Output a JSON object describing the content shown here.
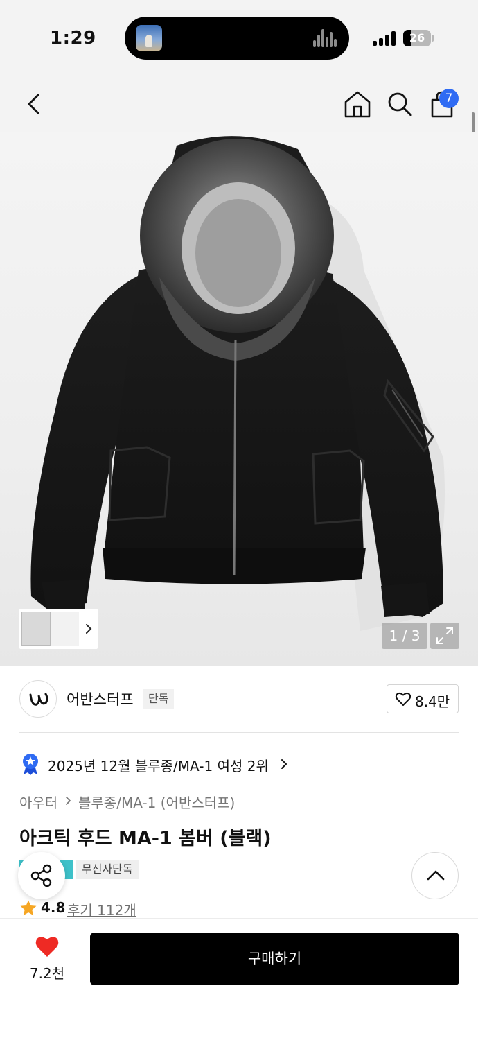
{
  "status_bar": {
    "time": "1:29",
    "battery": "26"
  },
  "nav": {
    "cart_count": "7",
    "icons": [
      "chevron-left-icon",
      "home-icon",
      "search-icon",
      "shopping-bag-icon"
    ],
    "badge_color": "#2f6bf3"
  },
  "gallery": {
    "counter": "1 / 3",
    "current_index": 1,
    "total": 3
  },
  "brand": {
    "name": "어반스터프",
    "tag": "단독",
    "likes": "8.4만"
  },
  "ranking": {
    "text": "2025년 12월 블루종/MA-1 여성 2위"
  },
  "breadcrumb": {
    "category": "아우터",
    "sub": "블루종/MA-1 (어반스터프)"
  },
  "product": {
    "title": "아크틱 후드 MA-1 봄버 (블랙)",
    "badge": "무신사단독",
    "rating": "4.8",
    "reviews": "후기 112개"
  },
  "bottom": {
    "wish_count": "7.2천",
    "buy_label": "구매하기"
  },
  "colors": {
    "accent_blue": "#2f6bf3",
    "heart_red": "#ee2a24",
    "star": "#f6a623",
    "teal_badge": "#3ec1c9",
    "buy_button": "#000000"
  }
}
